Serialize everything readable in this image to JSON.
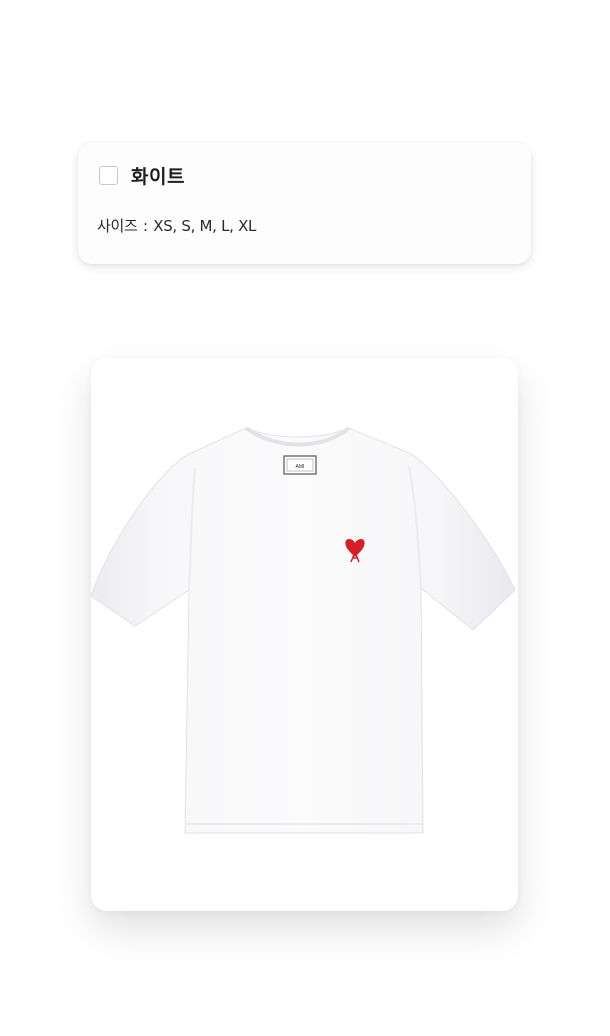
{
  "option": {
    "checked": false,
    "name": "화이트",
    "size_label": "사이즈",
    "size_separator": ":",
    "sizes": "XS, S, M, L, XL"
  },
  "product_image": {
    "label_tag_text": "AMI",
    "logo_color": "#d41f2a",
    "shirt_color": "#f7f7f9"
  }
}
